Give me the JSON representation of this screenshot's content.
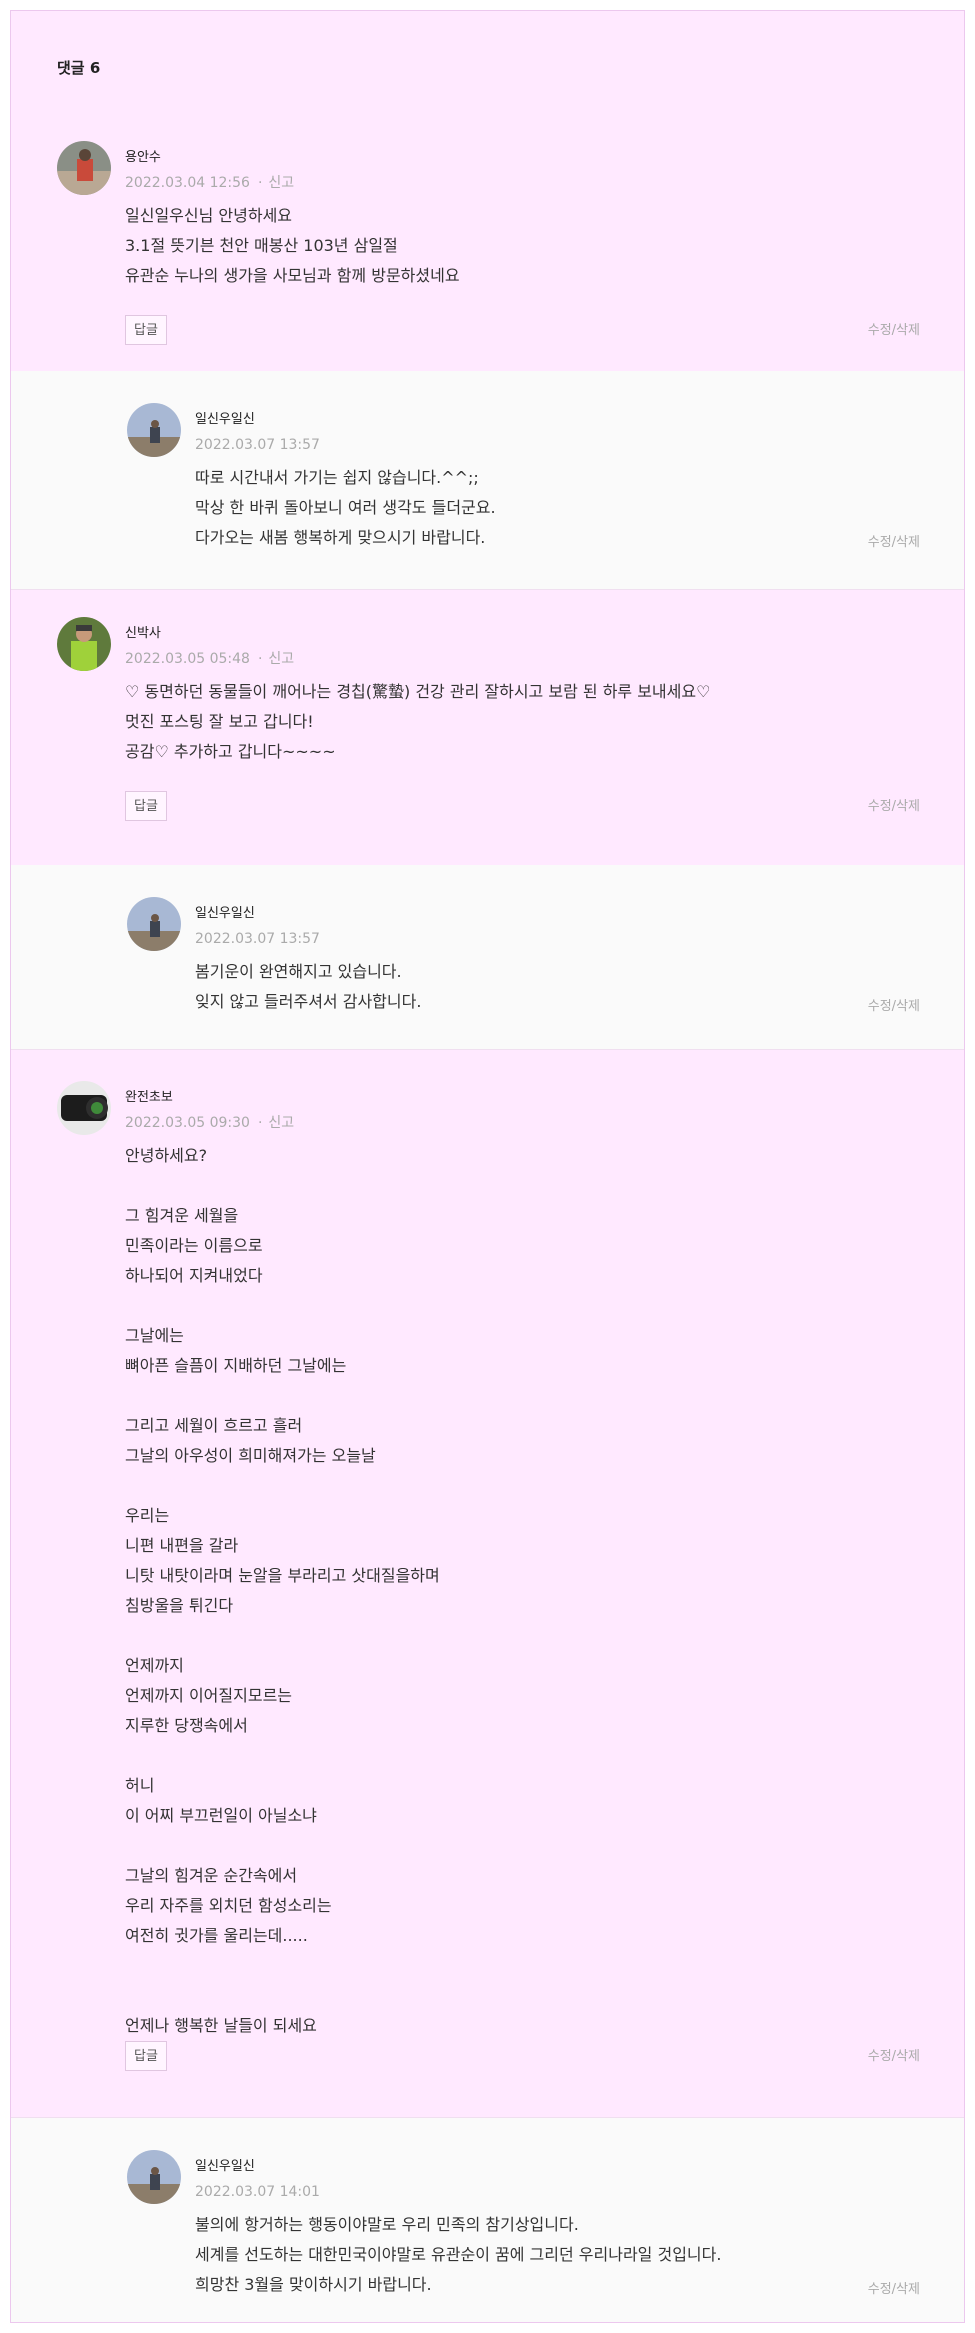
{
  "header": {
    "title": "댓글 6"
  },
  "common": {
    "reply_label": "답글",
    "edit_label": "수정/삭제",
    "report_label": "신고"
  },
  "comments": [
    {
      "author": "용안수",
      "date": "2022.03.04 12:56",
      "lines": [
        "일신일우신님 안녕하세요",
        "3.1절 뜻기븐 천안 매봉산 103년 삼일절",
        "유관순 누나의 생가을 사모님과 함께 방문하셨네요"
      ]
    },
    {
      "author": "일신우일신",
      "date": "2022.03.07 13:57",
      "lines": [
        "따로 시간내서 가기는 쉽지 않습니다.^^;;",
        "막상 한 바퀴 돌아보니 여러 생각도 들더군요.",
        "다가오는 새봄 행복하게 맞으시기 바랍니다."
      ]
    },
    {
      "author": "신박사",
      "date": "2022.03.05 05:48",
      "lines": [
        "♡ 동면하던 동물들이 깨어나는 경칩(驚蟄) 건강 관리 잘하시고 보람 된 하루 보내세요♡",
        "멋진 포스팅 잘 보고 갑니다!",
        "공감♡ 추가하고 갑니다~~~~"
      ]
    },
    {
      "author": "일신우일신",
      "date": "2022.03.07 13:57",
      "lines": [
        "봄기운이 완연해지고 있습니다.",
        "잊지 않고 들러주셔서 감사합니다."
      ]
    },
    {
      "author": "완전초보",
      "date": "2022.03.05 09:30",
      "lines": [
        "안녕하세요?",
        "",
        "그 힘겨운 세월을",
        "민족이라는 이름으로",
        "하나되어 지켜내었다",
        "",
        "그날에는",
        "뼈아픈 슬픔이 지배하던 그날에는",
        "",
        "그리고 세월이 흐르고 흘러",
        "그날의 아우성이 희미해져가는 오늘날",
        "",
        "우리는",
        "니편 내편을 갈라",
        "니탓 내탓이라며 눈알을 부라리고 삿대질을하며",
        "침방울을 튀긴다",
        "",
        "언제까지",
        "언제까지 이어질지모르는",
        "지루한 당쟁속에서",
        "",
        "허니",
        "이 어찌 부끄런일이 아닐소냐",
        "",
        "그날의 힘겨운 순간속에서",
        "우리 자주를 외치던 함성소리는",
        "여전히 귓가를 울리는데.....",
        "",
        "",
        "언제나 행복한 날들이 되세요"
      ]
    },
    {
      "author": "일신우일신",
      "date": "2022.03.07 14:01",
      "lines": [
        "불의에 항거하는 행동이야말로 우리 민족의 참기상입니다.",
        "세계를 선도하는 대한민국이야말로 유관순이 꿈에 그리던 우리나라일 것입니다.",
        "희망찬 3월을 맞이하시기 바랍니다."
      ]
    }
  ]
}
